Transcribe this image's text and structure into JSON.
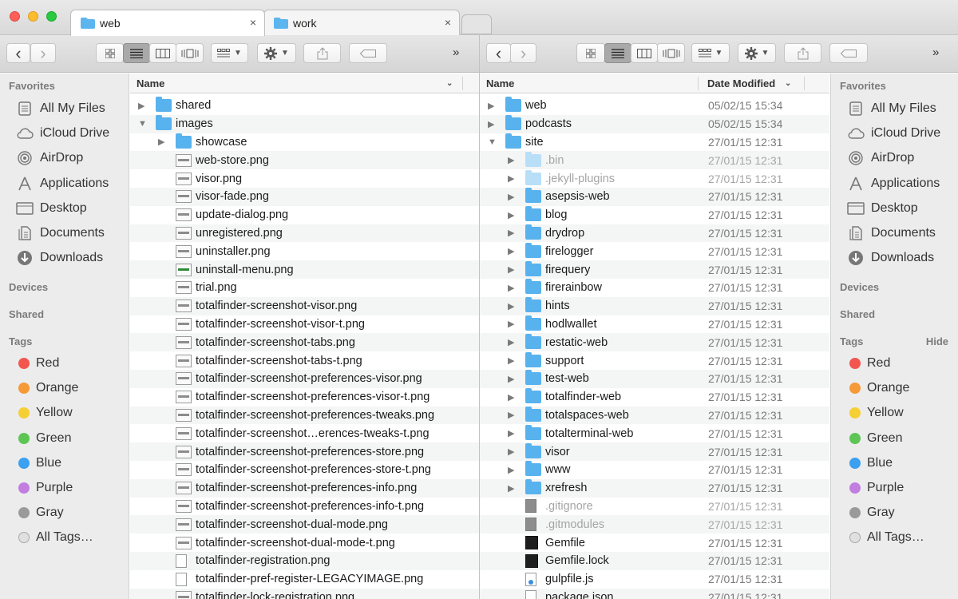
{
  "tabs": [
    {
      "label": "web",
      "close": "×",
      "active": true
    },
    {
      "label": "work",
      "close": "×",
      "active": false
    }
  ],
  "toolbar": {
    "back": "‹",
    "forward": "›",
    "more": "»",
    "view_icons": [
      "icon-view-icon",
      "list-view-icon",
      "column-view-icon",
      "coverflow-view-icon"
    ],
    "arrange_icon": "arrange-icon",
    "action_icon": "gear-icon",
    "share_icon": "share-icon",
    "tag_icon": "tag-icon"
  },
  "sidebar": {
    "favorites_heading": "Favorites",
    "favorites": [
      {
        "label": "All My Files",
        "icon": "all-files-icon"
      },
      {
        "label": "iCloud Drive",
        "icon": "cloud-icon"
      },
      {
        "label": "AirDrop",
        "icon": "airdrop-icon"
      },
      {
        "label": "Applications",
        "icon": "applications-icon"
      },
      {
        "label": "Desktop",
        "icon": "desktop-icon"
      },
      {
        "label": "Documents",
        "icon": "documents-icon"
      },
      {
        "label": "Downloads",
        "icon": "downloads-icon"
      }
    ],
    "devices_heading": "Devices",
    "shared_heading": "Shared",
    "tags_heading": "Tags",
    "hide_label": "Hide",
    "tags": [
      {
        "label": "Red",
        "color": "#f2564e"
      },
      {
        "label": "Orange",
        "color": "#f59a36"
      },
      {
        "label": "Yellow",
        "color": "#f6cf35"
      },
      {
        "label": "Green",
        "color": "#5cc553"
      },
      {
        "label": "Blue",
        "color": "#3ba0f0"
      },
      {
        "label": "Purple",
        "color": "#c17ee0"
      },
      {
        "label": "Gray",
        "color": "#9a9a9a"
      },
      {
        "label": "All Tags…",
        "color": "#e0e0e0"
      }
    ]
  },
  "left_pane": {
    "col_name": "Name",
    "rows": [
      {
        "name": "shared",
        "type": "folder",
        "depth": 0,
        "expand": "▶"
      },
      {
        "name": "images",
        "type": "folder",
        "depth": 0,
        "expand": "▼"
      },
      {
        "name": "showcase",
        "type": "folder",
        "depth": 1,
        "expand": "▶"
      },
      {
        "name": "web-store.png",
        "type": "image",
        "depth": 1
      },
      {
        "name": "visor.png",
        "type": "image",
        "depth": 1
      },
      {
        "name": "visor-fade.png",
        "type": "image",
        "depth": 1
      },
      {
        "name": "update-dialog.png",
        "type": "image",
        "depth": 1
      },
      {
        "name": "unregistered.png",
        "type": "image",
        "depth": 1
      },
      {
        "name": "uninstaller.png",
        "type": "image",
        "depth": 1
      },
      {
        "name": "uninstall-menu.png",
        "type": "image-green",
        "depth": 1
      },
      {
        "name": "trial.png",
        "type": "image",
        "depth": 1
      },
      {
        "name": "totalfinder-screenshot-visor.png",
        "type": "image",
        "depth": 1
      },
      {
        "name": "totalfinder-screenshot-visor-t.png",
        "type": "image",
        "depth": 1
      },
      {
        "name": "totalfinder-screenshot-tabs.png",
        "type": "image",
        "depth": 1
      },
      {
        "name": "totalfinder-screenshot-tabs-t.png",
        "type": "image",
        "depth": 1
      },
      {
        "name": "totalfinder-screenshot-preferences-visor.png",
        "type": "image",
        "depth": 1
      },
      {
        "name": "totalfinder-screenshot-preferences-visor-t.png",
        "type": "image",
        "depth": 1
      },
      {
        "name": "totalfinder-screenshot-preferences-tweaks.png",
        "type": "image",
        "depth": 1
      },
      {
        "name": "totalfinder-screenshot…erences-tweaks-t.png",
        "type": "image",
        "depth": 1
      },
      {
        "name": "totalfinder-screenshot-preferences-store.png",
        "type": "image",
        "depth": 1
      },
      {
        "name": "totalfinder-screenshot-preferences-store-t.png",
        "type": "image",
        "depth": 1
      },
      {
        "name": "totalfinder-screenshot-preferences-info.png",
        "type": "image",
        "depth": 1
      },
      {
        "name": "totalfinder-screenshot-preferences-info-t.png",
        "type": "image",
        "depth": 1
      },
      {
        "name": "totalfinder-screenshot-dual-mode.png",
        "type": "image",
        "depth": 1
      },
      {
        "name": "totalfinder-screenshot-dual-mode-t.png",
        "type": "image",
        "depth": 1
      },
      {
        "name": "totalfinder-registration.png",
        "type": "doc",
        "depth": 1
      },
      {
        "name": "totalfinder-pref-register-LEGACYIMAGE.png",
        "type": "doc",
        "depth": 1
      },
      {
        "name": "totalfinder-lock-registration.png",
        "type": "image",
        "depth": 1
      }
    ]
  },
  "right_pane": {
    "col_name": "Name",
    "col_date": "Date Modified",
    "rows": [
      {
        "name": "web",
        "type": "folder",
        "depth": 0,
        "expand": "▶",
        "date": "05/02/15 15:34"
      },
      {
        "name": "podcasts",
        "type": "folder",
        "depth": 0,
        "expand": "▶",
        "date": "05/02/15 15:34"
      },
      {
        "name": "site",
        "type": "folder",
        "depth": 0,
        "expand": "▼",
        "date": "27/01/15 12:31"
      },
      {
        "name": ".bin",
        "type": "folder-light",
        "depth": 1,
        "expand": "▶",
        "date": "27/01/15 12:31",
        "dim": true
      },
      {
        "name": ".jekyll-plugins",
        "type": "folder-light",
        "depth": 1,
        "expand": "▶",
        "date": "27/01/15 12:31",
        "dim": true
      },
      {
        "name": "asepsis-web",
        "type": "folder",
        "depth": 1,
        "expand": "▶",
        "date": "27/01/15 12:31"
      },
      {
        "name": "blog",
        "type": "folder",
        "depth": 1,
        "expand": "▶",
        "date": "27/01/15 12:31"
      },
      {
        "name": "drydrop",
        "type": "folder",
        "depth": 1,
        "expand": "▶",
        "date": "27/01/15 12:31"
      },
      {
        "name": "firelogger",
        "type": "folder",
        "depth": 1,
        "expand": "▶",
        "date": "27/01/15 12:31"
      },
      {
        "name": "firequery",
        "type": "folder",
        "depth": 1,
        "expand": "▶",
        "date": "27/01/15 12:31"
      },
      {
        "name": "firerainbow",
        "type": "folder",
        "depth": 1,
        "expand": "▶",
        "date": "27/01/15 12:31"
      },
      {
        "name": "hints",
        "type": "folder",
        "depth": 1,
        "expand": "▶",
        "date": "27/01/15 12:31"
      },
      {
        "name": "hodlwallet",
        "type": "folder",
        "depth": 1,
        "expand": "▶",
        "date": "27/01/15 12:31"
      },
      {
        "name": "restatic-web",
        "type": "folder",
        "depth": 1,
        "expand": "▶",
        "date": "27/01/15 12:31"
      },
      {
        "name": "support",
        "type": "folder",
        "depth": 1,
        "expand": "▶",
        "date": "27/01/15 12:31"
      },
      {
        "name": "test-web",
        "type": "folder",
        "depth": 1,
        "expand": "▶",
        "date": "27/01/15 12:31"
      },
      {
        "name": "totalfinder-web",
        "type": "folder",
        "depth": 1,
        "expand": "▶",
        "date": "27/01/15 12:31"
      },
      {
        "name": "totalspaces-web",
        "type": "folder",
        "depth": 1,
        "expand": "▶",
        "date": "27/01/15 12:31"
      },
      {
        "name": "totalterminal-web",
        "type": "folder",
        "depth": 1,
        "expand": "▶",
        "date": "27/01/15 12:31"
      },
      {
        "name": "visor",
        "type": "folder",
        "depth": 1,
        "expand": "▶",
        "date": "27/01/15 12:31"
      },
      {
        "name": "www",
        "type": "folder",
        "depth": 1,
        "expand": "▶",
        "date": "27/01/15 12:31"
      },
      {
        "name": "xrefresh",
        "type": "folder",
        "depth": 1,
        "expand": "▶",
        "date": "27/01/15 12:31"
      },
      {
        "name": ".gitignore",
        "type": "doc-gray",
        "depth": 1,
        "date": "27/01/15 12:31",
        "dim": true
      },
      {
        "name": ".gitmodules",
        "type": "doc-gray",
        "depth": 1,
        "date": "27/01/15 12:31",
        "dim": true
      },
      {
        "name": "Gemfile",
        "type": "doc-black",
        "depth": 1,
        "date": "27/01/15 12:31"
      },
      {
        "name": "Gemfile.lock",
        "type": "doc-black",
        "depth": 1,
        "date": "27/01/15 12:31"
      },
      {
        "name": "gulpfile.js",
        "type": "doc-js",
        "depth": 1,
        "date": "27/01/15 12:31"
      },
      {
        "name": "package.json",
        "type": "doc",
        "depth": 1,
        "date": "27/01/15 12:31"
      }
    ]
  }
}
